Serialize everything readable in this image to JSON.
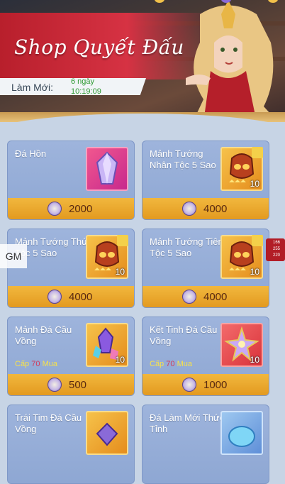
{
  "header": {
    "title": "Shop Quyết Đấu",
    "refresh_label": "Làm Mới:",
    "refresh_time_line1": "6 ngày",
    "refresh_time_line2": "10:19:09"
  },
  "gm_label": "GM",
  "side_status": {
    "line1": "166",
    "line2": "255",
    "line3": "220"
  },
  "items": [
    {
      "name": "Đá Hồn",
      "price": "2000",
      "qty": "",
      "level": "",
      "icon": "crystal-gem-icon"
    },
    {
      "name": "Mảnh Tướng Nhân Tộc 5 Sao",
      "price": "4000",
      "qty": "10",
      "level": "",
      "icon": "hero-mask-icon"
    },
    {
      "name": "Mảnh Tướng Thú Tộc 5 Sao",
      "price": "4000",
      "qty": "10",
      "level": "",
      "icon": "hero-mask-icon"
    },
    {
      "name": "Mảnh Tướng Tiên Tộc 5 Sao",
      "price": "4000",
      "qty": "10",
      "level": "",
      "icon": "hero-mask-icon"
    },
    {
      "name": "Mảnh Đá Cầu Vồng",
      "price": "500",
      "qty": "10",
      "level_prefix": "Cấp",
      "level_value": "70",
      "level_suffix": "Mua",
      "icon": "rainbow-shard-icon"
    },
    {
      "name": "Kết Tinh Đá Cầu Vồng",
      "price": "1000",
      "qty": "10",
      "level_prefix": "Cấp",
      "level_value": "70",
      "level_suffix": "Mua",
      "icon": "star-crystal-icon"
    },
    {
      "name": "Trái Tim Đá Cầu Vồng",
      "price": "",
      "qty": "",
      "icon": "rainbow-heart-icon"
    },
    {
      "name": "Đá Làm Mới Thức Tỉnh",
      "price": "",
      "qty": "",
      "icon": "awaken-gem-icon"
    }
  ]
}
